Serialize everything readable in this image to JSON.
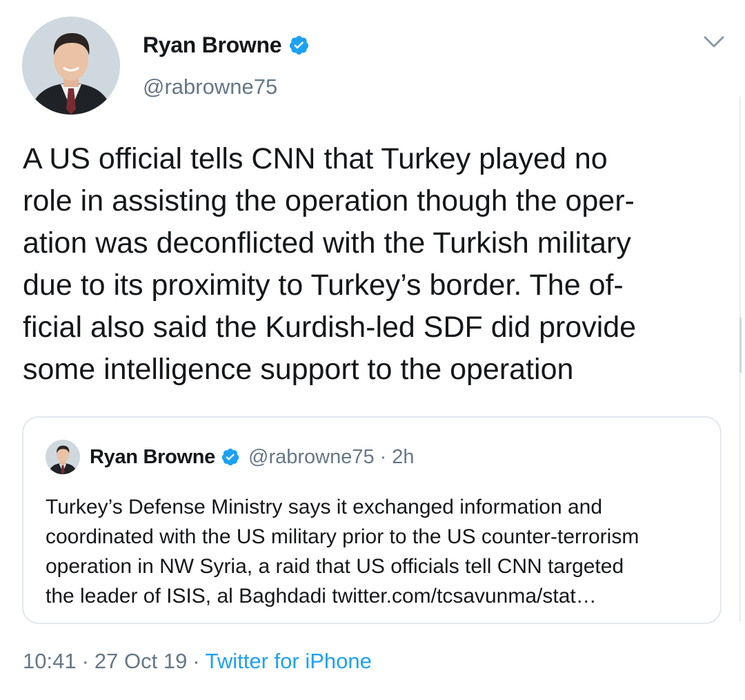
{
  "author": {
    "display_name": "Ryan Browne",
    "handle": "@rabrowne75",
    "verified_icon": "verified-badge-icon",
    "avatar_icon": "avatar"
  },
  "menu": {
    "chevron_icon": "chevron-down-icon"
  },
  "tweet": {
    "text": "A US official tells CNN that Turkey played no\nrole in assisting the operation though the oper-\nation was deconflicted with the Turkish military\ndue to its proximity to Turkey’s border. The of-\nficial also said the Kurdish-led SDF did provide\nsome intelligence support to the operation"
  },
  "quote": {
    "display_name": "Ryan Browne",
    "handle": "@rabrowne75",
    "separator": "·",
    "time": "2h",
    "text": "Turkey’s Defense Ministry says it exchanged information and\ncoordinated with the US military prior to the US counter-terrorism\noperation in NW Syria, a raid that US officials tell CNN targeted\nthe leader of ISIS, al Baghdadi twitter.com/tcsavunma/stat…"
  },
  "footer": {
    "time": "10:41",
    "sep1": "·",
    "date": "27 Oct 19",
    "sep2": "·",
    "source": "Twitter for iPhone"
  },
  "colors": {
    "accent": "#1da1f2",
    "text": "#14171a",
    "secondary": "#657786",
    "border": "#e1e8ed"
  }
}
